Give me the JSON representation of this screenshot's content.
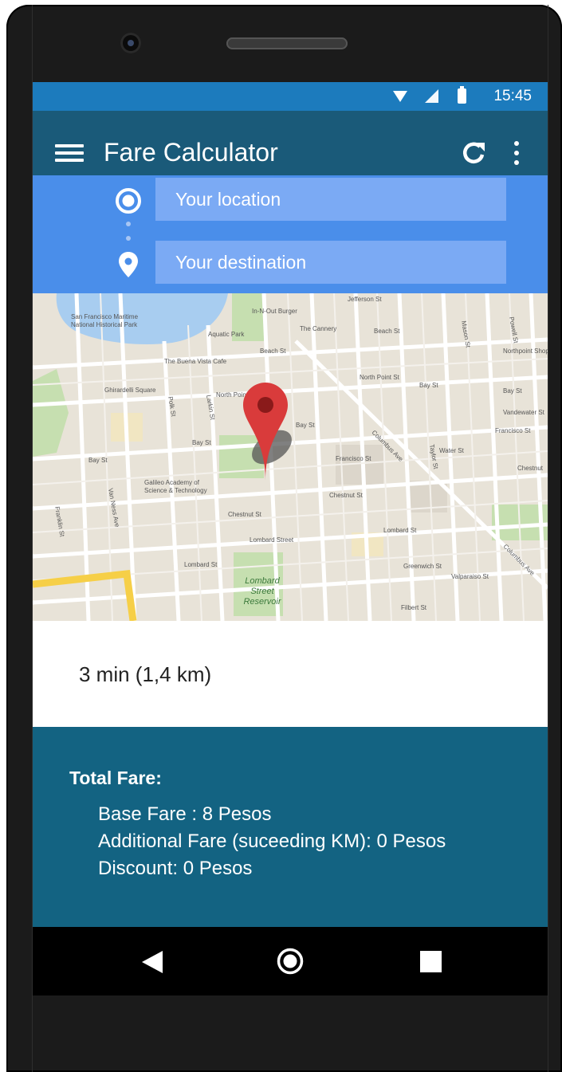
{
  "status_bar": {
    "time": "15:45"
  },
  "app_bar": {
    "title": "Fare Calculator"
  },
  "route": {
    "origin_placeholder": "Your location",
    "destination_placeholder": "Your destination"
  },
  "map": {
    "labels": {
      "maritime": "San Francisco Maritime",
      "maritime2": "National Historical Park",
      "aquatic": "Aquatic Park",
      "innout": "In-N-Out Burger",
      "cannery": "The Cannery",
      "beach1": "Beach St",
      "beach2": "Beach St",
      "buena": "The Buena Vista Cafe",
      "ghirardelli": "Ghirardelli Square",
      "northpoint1": "North Point St",
      "northpoint2": "North Point St",
      "bay1": "Bay St",
      "bay2": "Bay St",
      "bay3": "Bay St",
      "bay4": "Bay St",
      "bay5": "Bay St",
      "northpoint_center": "Northpoint Shopping Ce",
      "vandewater": "Vandewater St",
      "francisco1": "Francisco St",
      "francisco2": "Francisco St",
      "water": "Water St",
      "chestnut1": "Chestnut St",
      "chestnut2": "Chestnut St",
      "chestnut3": "Chestnut",
      "galileo1": "Galileo Academy of",
      "galileo2": "Science & Technology",
      "lombard1": "Lombard St",
      "lombard2": "Lombard Street",
      "lombard3": "Lombard St",
      "greenwich": "Greenwich St",
      "valparaiso": "Valparaiso St",
      "filbert": "Filbert St",
      "columbus1": "Columbus Ave",
      "columbus2": "Columbus Ave",
      "vanness": "Van Ness Ave",
      "polk": "Polk St",
      "larkin": "Larkin St",
      "mason": "Mason St",
      "taylor": "Taylor St",
      "powell": "Powell St",
      "franklin": "Franklin St",
      "jefferson": "Jefferson St",
      "reservoir1": "Lombard",
      "reservoir2": "Street",
      "reservoir3": "Reservoir"
    }
  },
  "trip": {
    "summary": "3 min (1,4 km)"
  },
  "fare": {
    "title": "Total Fare:",
    "base": "Base Fare  : 8 Pesos",
    "additional": "Additional Fare (suceeding KM): 0 Pesos",
    "discount": "Discount: 0 Pesos"
  },
  "icons": {
    "status": [
      "wifi-icon",
      "cell-signal-icon",
      "battery-icon"
    ],
    "app_bar": [
      "menu-icon",
      "refresh-icon",
      "more-vert-icon"
    ],
    "route": [
      "my-location-icon",
      "place-pin-icon"
    ],
    "nav": [
      "back-icon",
      "home-icon",
      "recents-icon"
    ]
  },
  "colors": {
    "status_bar": "#1c7bbd",
    "app_bar": "#1a5a79",
    "route_panel": "#4a8eea",
    "route_field": "#7baaf4",
    "fare_panel": "#136382",
    "map_pin": "#d32f2f"
  }
}
